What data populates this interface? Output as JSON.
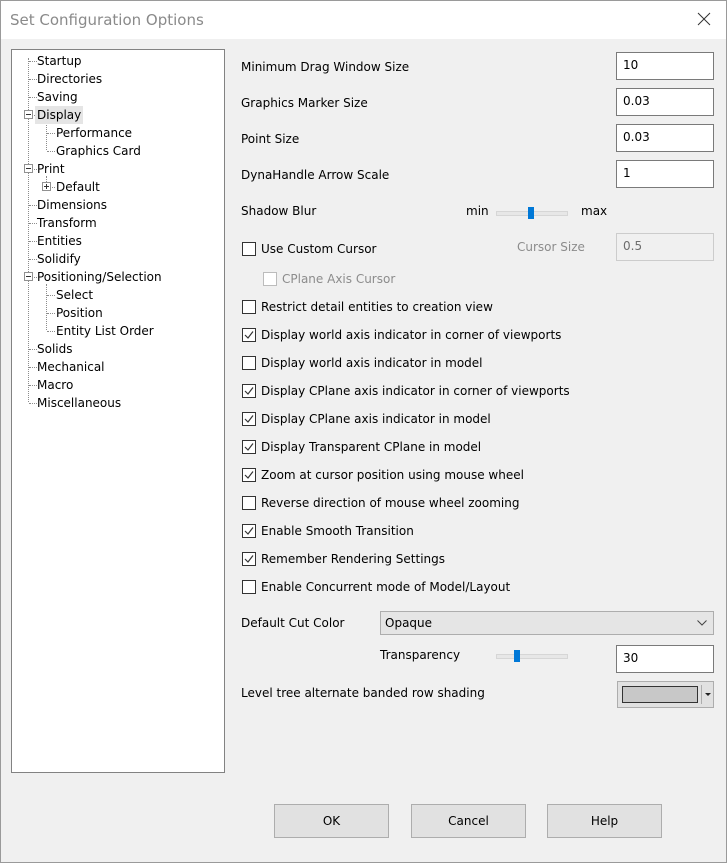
{
  "window": {
    "title": "Set Configuration Options"
  },
  "tree": {
    "items": [
      {
        "label": "Startup"
      },
      {
        "label": "Directories"
      },
      {
        "label": "Saving"
      },
      {
        "label": "Display",
        "expanded": true,
        "selected": true
      },
      {
        "label": "Performance"
      },
      {
        "label": "Graphics Card"
      },
      {
        "label": "Print",
        "expanded": true
      },
      {
        "label": "Default",
        "expanded": false
      },
      {
        "label": "Dimensions"
      },
      {
        "label": "Transform"
      },
      {
        "label": "Entities"
      },
      {
        "label": "Solidify"
      },
      {
        "label": "Positioning/Selection",
        "expanded": true
      },
      {
        "label": "Select"
      },
      {
        "label": "Position"
      },
      {
        "label": "Entity List Order"
      },
      {
        "label": "Solids"
      },
      {
        "label": "Mechanical"
      },
      {
        "label": "Macro"
      },
      {
        "label": "Miscellaneous"
      }
    ]
  },
  "fields": {
    "min_drag": {
      "label": "Minimum Drag Window Size",
      "value": "10"
    },
    "marker_size": {
      "label": "Graphics Marker Size",
      "value": "0.03"
    },
    "point_size": {
      "label": "Point Size",
      "value": "0.03"
    },
    "dynahandle": {
      "label": "DynaHandle Arrow Scale",
      "value": "1"
    }
  },
  "shadow_blur": {
    "label": "Shadow Blur",
    "min_label": "min",
    "max_label": "max",
    "value_fraction": 0.5
  },
  "custom_cursor": {
    "label": "Use Custom Cursor",
    "checked": false,
    "size_label": "Cursor Size",
    "size_value": "0.5"
  },
  "cplane_cursor": {
    "label": "CPlane Axis Cursor",
    "checked": false,
    "disabled": true
  },
  "checkboxes": [
    {
      "label": "Restrict detail entities to creation view",
      "checked": false
    },
    {
      "label": "Display world axis indicator in corner of viewports",
      "checked": true
    },
    {
      "label": "Display world axis indicator in model",
      "checked": false
    },
    {
      "label": "Display CPlane axis indicator in corner of viewports",
      "checked": true
    },
    {
      "label": "Display CPlane axis indicator in model",
      "checked": true
    },
    {
      "label": "Display Transparent CPlane in model",
      "checked": true
    },
    {
      "label": "Zoom at cursor position using mouse wheel",
      "checked": true
    },
    {
      "label": "Reverse direction of mouse wheel zooming",
      "checked": false
    },
    {
      "label": "Enable Smooth Transition",
      "checked": true
    },
    {
      "label": "Remember Rendering Settings",
      "checked": true
    },
    {
      "label": "Enable Concurrent mode of Model/Layout",
      "checked": false
    }
  ],
  "cut_color": {
    "label": "Default Cut Color",
    "selected": "Opaque"
  },
  "transparency": {
    "label": "Transparency",
    "value": "30",
    "slider_fraction": 0.3
  },
  "banded_shading": {
    "label": "Level tree alternate banded row shading",
    "color": "#c8c8c8"
  },
  "buttons": {
    "ok": "OK",
    "cancel": "Cancel",
    "help": "Help"
  }
}
